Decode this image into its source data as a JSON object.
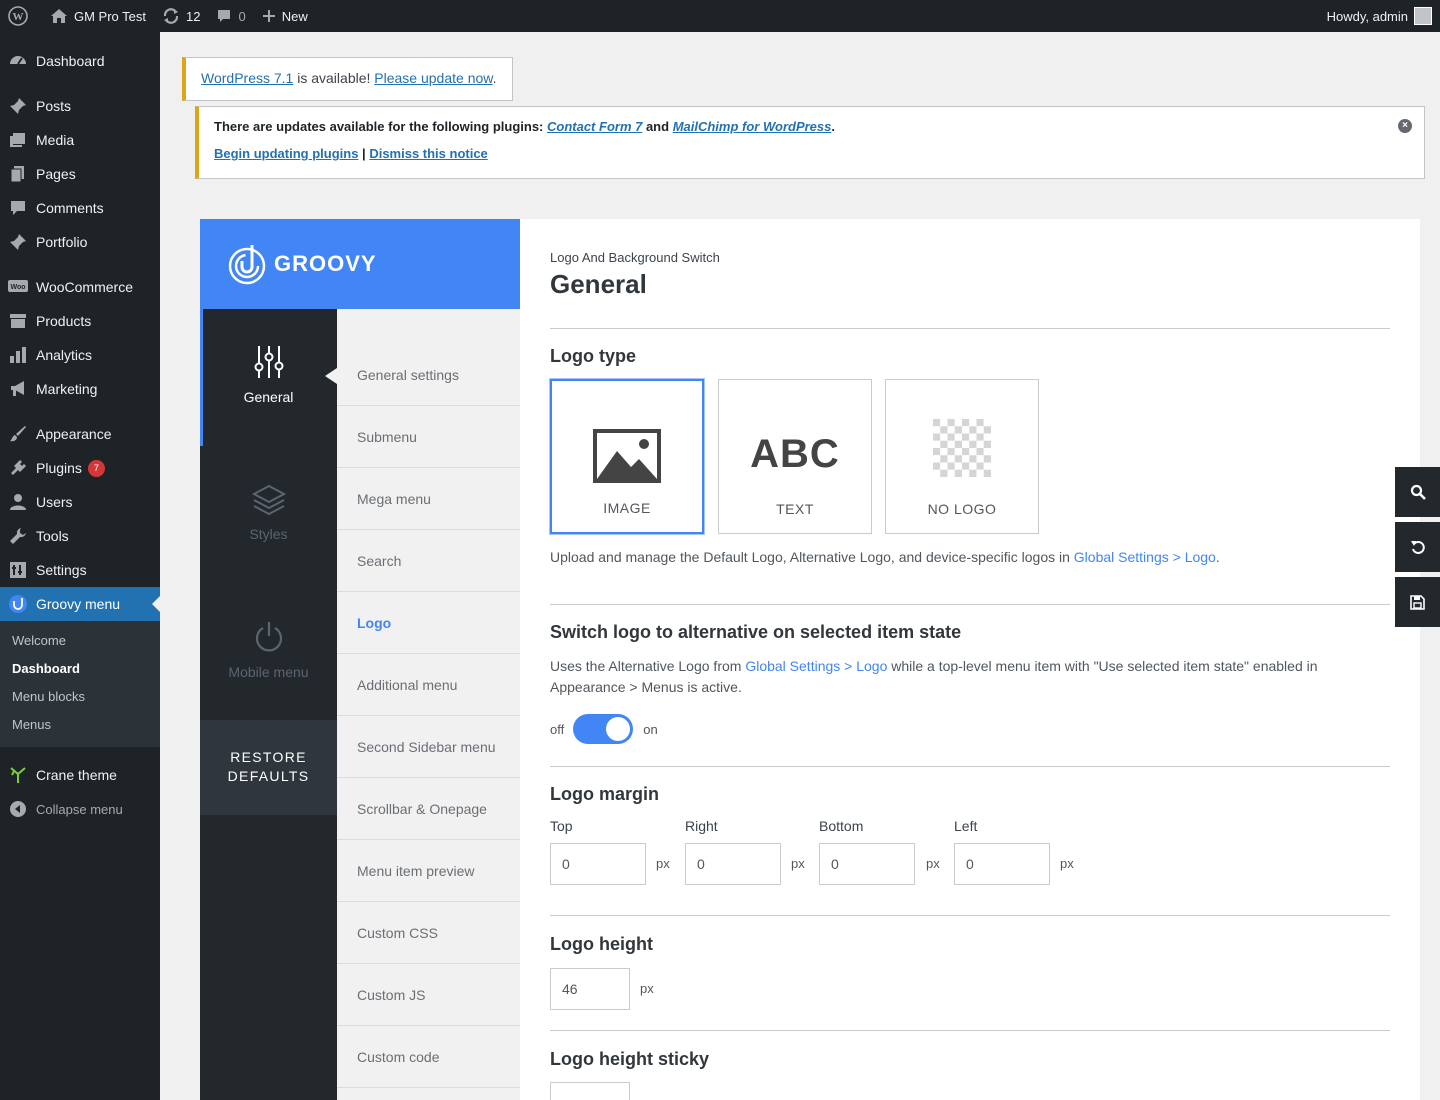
{
  "adminbar": {
    "site_name": "GM Pro Test",
    "updates_count": "12",
    "comments_count": "0",
    "new_label": "New",
    "howdy": "Howdy, admin"
  },
  "sidebar": {
    "items": [
      {
        "label": "Dashboard",
        "icon": "dashboard-icon"
      },
      {
        "label": "Posts",
        "icon": "pin-icon"
      },
      {
        "label": "Media",
        "icon": "media-icon"
      },
      {
        "label": "Pages",
        "icon": "pages-icon"
      },
      {
        "label": "Comments",
        "icon": "comment-icon"
      },
      {
        "label": "Portfolio",
        "icon": "pin-icon"
      },
      {
        "label": "WooCommerce",
        "icon": "woo-icon"
      },
      {
        "label": "Products",
        "icon": "archive-icon"
      },
      {
        "label": "Analytics",
        "icon": "chart-icon"
      },
      {
        "label": "Marketing",
        "icon": "megaphone-icon"
      },
      {
        "label": "Appearance",
        "icon": "brush-icon"
      },
      {
        "label": "Plugins",
        "icon": "plug-icon",
        "badge": "7"
      },
      {
        "label": "Users",
        "icon": "user-icon"
      },
      {
        "label": "Tools",
        "icon": "wrench-icon"
      },
      {
        "label": "Settings",
        "icon": "settings-icon"
      },
      {
        "label": "Groovy menu",
        "icon": "groovy-icon"
      }
    ],
    "submenu": [
      "Welcome",
      "Dashboard",
      "Menu blocks",
      "Menus"
    ],
    "crane": "Crane theme",
    "collapse": "Collapse menu"
  },
  "notice1": {
    "link1": "WordPress 7.1",
    "text": " is available! ",
    "link2": "Please update now",
    "end": "."
  },
  "notice2": {
    "text1": "There are updates available for the following plugins: ",
    "plugin1": "Contact Form 7",
    "and": " and ",
    "plugin2": "MailChimp for WordPress",
    "end": ".",
    "begin": "Begin updating plugins",
    "sep": " | ",
    "dismiss": "Dismiss this notice"
  },
  "groovy": {
    "brand": "GROOVY",
    "tabs": [
      "General",
      "Styles",
      "Mobile menu"
    ],
    "restore_line1": "RESTORE",
    "restore_line2": "DEFAULTS",
    "subnav": [
      "General settings",
      "Submenu",
      "Mega menu",
      "Search",
      "Logo",
      "Additional menu",
      "Second Sidebar menu",
      "Scrollbar & Onepage",
      "Menu item preview",
      "Custom CSS",
      "Custom JS",
      "Custom code"
    ],
    "accent": "#4285f4"
  },
  "content": {
    "breadcrumb": "Logo And Background Switch",
    "heading": "General",
    "logo_type": {
      "title": "Logo type",
      "options": [
        "IMAGE",
        "TEXT",
        "NO LOGO"
      ],
      "abc": "ABC",
      "selected": "IMAGE",
      "desc_pre": "Upload and manage the Default Logo, Alternative Logo, and device-specific logos in ",
      "desc_link": "Global Settings > Logo",
      "desc_post": "."
    },
    "switch": {
      "title": "Switch logo to alternative on selected item state",
      "desc_pre": "Uses the Alternative Logo from ",
      "desc_link": "Global Settings > Logo",
      "desc_post1": " while a top-level menu item with \"Use selected item state\" enabled in",
      "desc_post2": "Appearance > Menus is active.",
      "off": "off",
      "on": "on",
      "enabled": true
    },
    "margin": {
      "title": "Logo margin",
      "fields": [
        {
          "label": "Top",
          "value": "0"
        },
        {
          "label": "Right",
          "value": "0"
        },
        {
          "label": "Bottom",
          "value": "0"
        },
        {
          "label": "Left",
          "value": "0"
        }
      ],
      "unit": "px"
    },
    "height": {
      "title": "Logo height",
      "value": "46",
      "unit": "px"
    },
    "height_sticky": {
      "title": "Logo height sticky"
    }
  }
}
